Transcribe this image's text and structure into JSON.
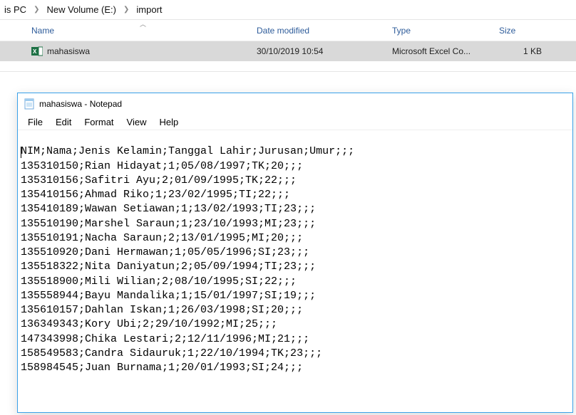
{
  "breadcrumb": {
    "crumb1": "is PC",
    "crumb2": "New Volume (E:)",
    "crumb3": "import"
  },
  "columns": {
    "name": "Name",
    "date": "Date modified",
    "type": "Type",
    "size": "Size"
  },
  "file_row": {
    "name": "mahasiswa",
    "date": "30/10/2019 10:54",
    "type": "Microsoft Excel Co...",
    "size": "1 KB"
  },
  "notepad": {
    "title": "mahasiswa - Notepad",
    "menu": {
      "file": "File",
      "edit": "Edit",
      "format": "Format",
      "view": "View",
      "help": "Help"
    },
    "lines": [
      "NIM;Nama;Jenis Kelamin;Tanggal Lahir;Jurusan;Umur;;;",
      "135310150;Rian Hidayat;1;05/08/1997;TK;20;;;",
      "135310156;Safitri Ayu;2;01/09/1995;TK;22;;;",
      "135410156;Ahmad Riko;1;23/02/1995;TI;22;;;",
      "135410189;Wawan Setiawan;1;13/02/1993;TI;23;;;",
      "135510190;Marshel Saraun;1;23/10/1993;MI;23;;;",
      "135510191;Nacha Saraun;2;13/01/1995;MI;20;;;",
      "135510920;Dani Hermawan;1;05/05/1996;SI;23;;;",
      "135518322;Nita Daniyatun;2;05/09/1994;TI;23;;;",
      "135518900;Mili Wilian;2;08/10/1995;SI;22;;;",
      "135558944;Bayu Mandalika;1;15/01/1997;SI;19;;;",
      "135610157;Dahlan Iskan;1;26/03/1998;SI;20;;;",
      "136349343;Kory Ubi;2;29/10/1992;MI;25;;;",
      "147343998;Chika Lestari;2;12/11/1996;MI;21;;;",
      "158549583;Candra Sidauruk;1;22/10/1994;TK;23;;;",
      "158984545;Juan Burnama;1;20/01/1993;SI;24;;;"
    ]
  }
}
